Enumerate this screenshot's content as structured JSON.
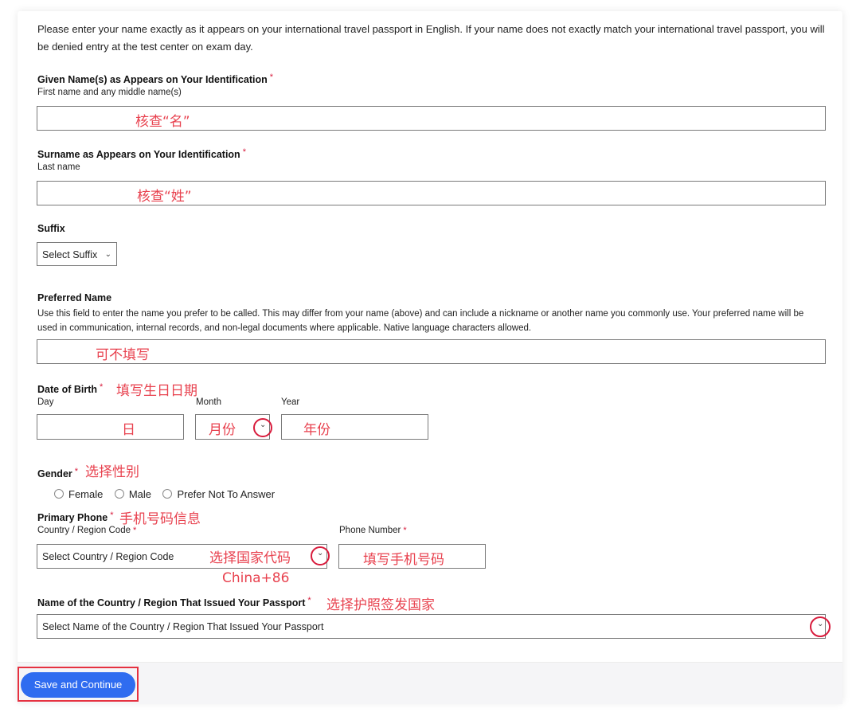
{
  "intro_text": "Please enter your name exactly as it appears on your international travel passport in English. If your name does not exactly match your international travel passport, you will be denied entry at the test center on exam day.",
  "required_mark": "*",
  "given_name": {
    "label": "Given Name(s) as Appears on Your Identification",
    "sublabel": "First name and any middle name(s)",
    "annotation": "核查“名”"
  },
  "surname": {
    "label": "Surname as Appears on Your Identification",
    "sublabel": "Last name",
    "annotation": "核查“姓”"
  },
  "suffix": {
    "label": "Suffix",
    "selected": "Select Suffix"
  },
  "preferred_name": {
    "label": "Preferred Name",
    "description": "Use this field to enter the name you prefer to be called. This may differ from your name (above) and can include a nickname or another name you commonly use. Your preferred name will be used in communication, internal records, and non-legal documents where applicable. Native language characters allowed.",
    "annotation": "可不填写"
  },
  "dob": {
    "label": "Date of Birth",
    "annotation": "填写生日日期",
    "day_label": "Day",
    "month_label": "Month",
    "year_label": "Year",
    "day_annotation": "日",
    "month_annotation": "月份",
    "year_annotation": "年份"
  },
  "gender": {
    "label": "Gender",
    "annotation": "选择性别",
    "options": [
      "Female",
      "Male",
      "Prefer Not To Answer"
    ]
  },
  "phone": {
    "label": "Primary Phone",
    "annotation": "手机号码信息",
    "country_label": "Country / Region Code",
    "country_selected": "Select Country / Region Code",
    "country_annotation": "选择国家代码",
    "country_hint": "China+86",
    "number_label": "Phone Number",
    "number_annotation": "填写手机号码"
  },
  "passport_country": {
    "label": "Name of the Country / Region That Issued Your Passport",
    "annotation": "选择护照签发国家",
    "selected": "Select Name of the Country / Region That Issued Your Passport"
  },
  "save_button": "Save and Continue",
  "icons": {
    "chevron": "chevron-down-icon"
  },
  "colors": {
    "accent": "#2f6cf0",
    "annotation": "#e8424f",
    "required": "#d81b3c"
  }
}
